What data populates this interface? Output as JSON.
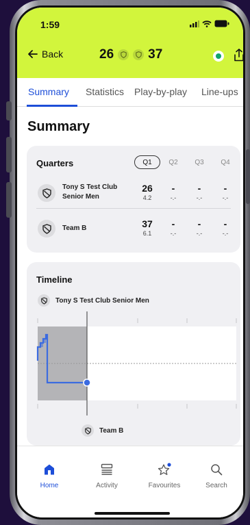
{
  "status_bar": {
    "time": "1:59"
  },
  "header": {
    "back_label": "Back",
    "home_score": "26",
    "away_score": "37",
    "colors": {
      "accent": "#d2f53c",
      "live": "#11a36b"
    }
  },
  "tabs": [
    {
      "label": "Summary",
      "active": true
    },
    {
      "label": "Statistics",
      "active": false
    },
    {
      "label": "Play-by-play",
      "active": false
    },
    {
      "label": "Line-ups",
      "active": false
    }
  ],
  "page_title": "Summary",
  "quarters": {
    "title": "Quarters",
    "headers": [
      "Q1",
      "Q2",
      "Q3",
      "Q4"
    ],
    "selected": "Q1",
    "teams": [
      {
        "name_line1": "Tony S Test Club",
        "name_line2": "Senior Men",
        "scores": [
          "26",
          "-",
          "-",
          "-"
        ],
        "sub": [
          "4.2",
          "-.-",
          "-.-",
          "-.-"
        ]
      },
      {
        "name_line1": "Team B",
        "name_line2": "",
        "scores": [
          "37",
          "-",
          "-",
          "-"
        ],
        "sub": [
          "6.1",
          "-.-",
          "-.-",
          "-.-"
        ]
      }
    ]
  },
  "timeline": {
    "title": "Timeline",
    "top_team": "Tony S Test Club Senior Men",
    "bottom_team": "Team B"
  },
  "tab_bar": [
    {
      "label": "Home",
      "icon": "home-icon",
      "active": true
    },
    {
      "label": "Activity",
      "icon": "activity-icon",
      "active": false
    },
    {
      "label": "Favourites",
      "icon": "star-icon",
      "active": false
    },
    {
      "label": "Search",
      "icon": "search-icon",
      "active": false
    }
  ]
}
